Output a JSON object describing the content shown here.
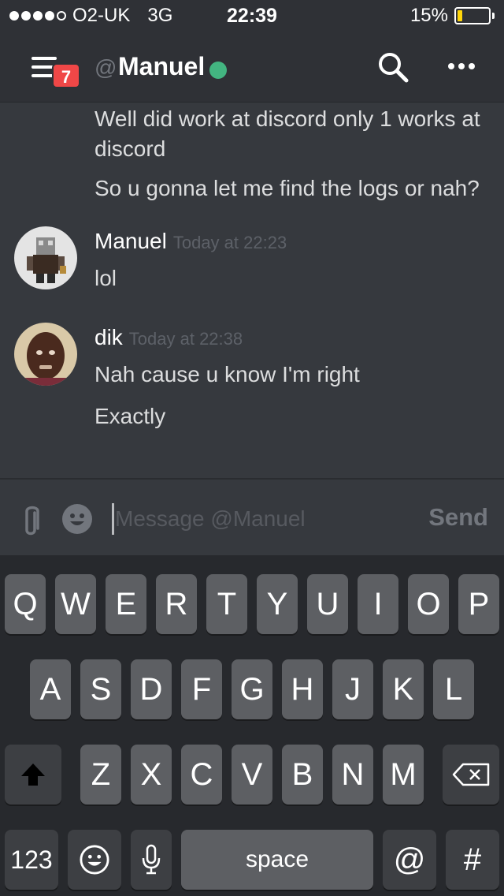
{
  "status_bar": {
    "carrier": "O2-UK",
    "network": "3G",
    "time": "22:39",
    "battery_percent": "15%",
    "battery_level": 0.15,
    "signal_bars": 4,
    "signal_max": 5
  },
  "header": {
    "menu_icon": "hamburger-icon",
    "unread_badge": "7",
    "at_symbol": "@",
    "channel_name": "Manuel",
    "online_color": "#43b581",
    "search_icon": "search-icon",
    "more_icon": "ellipsis-icon"
  },
  "messages": {
    "cont_1": "Well did work at discord only 1 works at discord",
    "cont_2": "So u gonna let me find the logs or nah?",
    "group_manuel": {
      "author": "Manuel",
      "timestamp": "Today at 22:23",
      "text_1": "lol"
    },
    "group_dik": {
      "author": "dik",
      "timestamp": "Today at 22:38",
      "text_1": "Nah cause u know I'm right",
      "text_2": "Exactly"
    }
  },
  "composer": {
    "placeholder": "Message @Manuel",
    "send_label": "Send",
    "attach_icon": "paperclip-icon",
    "emoji_icon": "emoji-icon"
  },
  "keyboard": {
    "row1": [
      "Q",
      "W",
      "E",
      "R",
      "T",
      "Y",
      "U",
      "I",
      "O",
      "P"
    ],
    "row2": [
      "A",
      "S",
      "D",
      "F",
      "G",
      "H",
      "J",
      "K",
      "L"
    ],
    "row3": [
      "Z",
      "X",
      "C",
      "V",
      "B",
      "N",
      "M"
    ],
    "numbers_label": "123",
    "space_label": "space",
    "at_label": "@",
    "hash_label": "#",
    "shift_icon": "shift-icon",
    "backspace_icon": "backspace-icon",
    "emoji_key_icon": "emoji-icon",
    "mic_icon": "microphone-icon"
  },
  "colors": {
    "background": "#36393e",
    "header": "#2f3136",
    "badge": "#f04747",
    "battery": "#ffd60a"
  }
}
